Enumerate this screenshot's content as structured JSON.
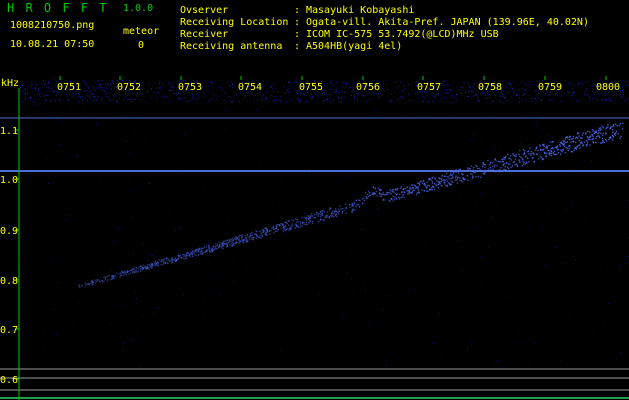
{
  "app": {
    "name": "H R O F F T",
    "version": "1.0.0"
  },
  "file": {
    "name": "1008210750.png",
    "datetime": "10.08.21 07:50"
  },
  "meteor": {
    "label": "meteor",
    "count": "0"
  },
  "info": [
    {
      "key": "Ovserver",
      "sep": ":",
      "value": "Masayuki Kobayashi"
    },
    {
      "key": "Receiving Location",
      "sep": ":",
      "value": "Ogata-vill. Akita-Pref. JAPAN (139.96E, 40.02N)"
    },
    {
      "key": "Receiver",
      "sep": ":",
      "value": "ICOM IC-575 53.7492(@LCD)MHz USB"
    },
    {
      "key": "Receiving antenna",
      "sep": ":",
      "value": "A504HB(yagi 4el)"
    }
  ],
  "axes": {
    "y_unit": "kHz",
    "y_ticks": [
      "1.1",
      "1.0",
      "0.9",
      "0.8",
      "0.7",
      "0.6"
    ],
    "time_ticks": [
      "0751",
      "0752",
      "0753",
      "0754",
      "0755",
      "0756",
      "0757",
      "0758",
      "0759",
      "0800"
    ]
  },
  "colors": {
    "background": "#000000",
    "text": "#ffff00",
    "title": "#00c800",
    "axis": "#00c800",
    "noise": "#2a2aff",
    "trace": "#4f6bff",
    "hline": "#4e6bd6",
    "greyline": "#9a9a9a"
  }
}
